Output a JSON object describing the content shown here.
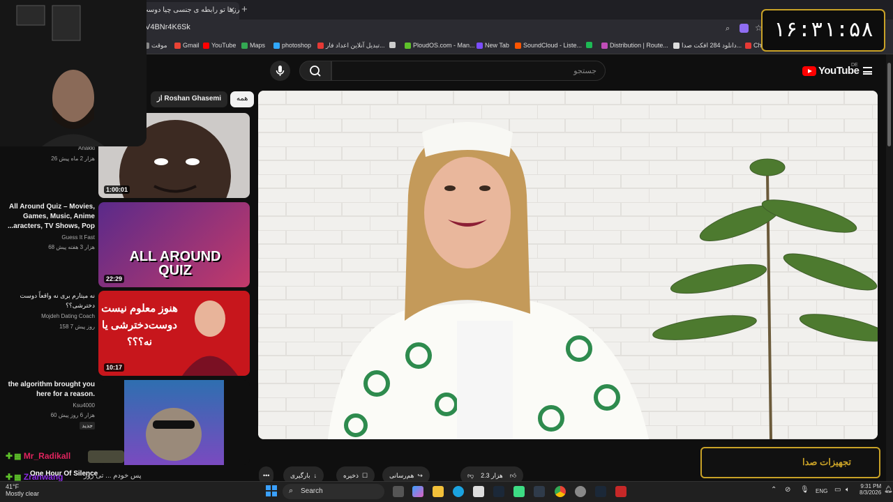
{
  "browser": {
    "tab_title": "مرزها تو رابطه ی جنسی چیا دوست",
    "url": "V4BNr4K6Sk",
    "bookmarks": [
      {
        "label": "موقت",
        "color": "#888888"
      },
      {
        "label": "Gmail",
        "color": "#ea4335"
      },
      {
        "label": "YouTube",
        "color": "#ff0000"
      },
      {
        "label": "Maps",
        "color": "#34a853"
      },
      {
        "label": "photoshop",
        "color": "#31a8ff"
      },
      {
        "label": "تبدیل آنلاین اعداد فار...",
        "color": "#e53935"
      },
      {
        "label": "",
        "color": "#cccccc"
      },
      {
        "label": "PloudOS.com - Man...",
        "color": "#5ec22a"
      },
      {
        "label": "New Tab",
        "color": "#7b4dff"
      },
      {
        "label": "SoundCloud - Liste...",
        "color": "#ff5500"
      },
      {
        "label": "",
        "color": "#1db954"
      },
      {
        "label": "Distribution | Route...",
        "color": "#c04db8"
      },
      {
        "label": "دانلود 284 افکت صدا...",
        "color": "#dddddd"
      },
      {
        "label": "Ch",
        "color": "#e53935"
      }
    ]
  },
  "youtube": {
    "logo_text": "YouTube",
    "region": "DE",
    "search_placeholder": "جستجو",
    "chips": {
      "all": "همه",
      "from": "از Roshan Ghasemi"
    }
  },
  "recommendations": [
    {
      "title": "",
      "channel": "Anakki",
      "meta": "26 هزار  2 ماه پیش",
      "duration": "1:00:01",
      "thumb_color": "#c7c4c2"
    },
    {
      "title": "All Around Quiz – Movies, Games, Music, Anime ...aracters, TV Shows, Pop",
      "channel": "Guess It Fast",
      "meta": "68 هزار  3 هفته پیش",
      "duration": "22:29",
      "thumb_color": "#7a3aa0",
      "thumb_text": "ALL AROUND QUIZ"
    },
    {
      "title": "نه میتارم بری نه واقعاً دوست دخترشی؟؟",
      "channel": "Mojdeh Dating Coach",
      "meta": "158  7 روز پیش",
      "duration": "10:17",
      "thumb_color": "#c7161c",
      "thumb_text": "هنوز معلوم نیست دوست‌دخترشی یا نه؟؟؟"
    },
    {
      "title": "the algorithm brought you here for a reason.",
      "channel": "Ksu4000",
      "meta": "60 هزار  6 روز پیش",
      "badge": "جدید",
      "thumb_color": "#4b2f8a"
    }
  ],
  "overlay": {
    "clock": "۱۶:۳۱:۵۸",
    "sound_label": "تجهیزات صدا"
  },
  "actions": {
    "likes": "2.3 هزار",
    "share": "هم‌رسانی",
    "save": "ذخیره",
    "download": "بارگیری",
    "more": "•••"
  },
  "chat": [
    {
      "user": "Mr_Radikall",
      "color": "#e0245e"
    },
    {
      "user": "Zranwang",
      "color": "#8a2be2"
    }
  ],
  "overlay_texts": {
    "ticker": "One Hour Of Silence",
    "persian_fragment": "پس خودم ... تی روز",
    "weather_temp": "41°F",
    "weather_desc": "Mostly clear"
  },
  "taskbar": {
    "search_label": "Search",
    "language": "ENG",
    "time": "9:31 PM",
    "date": "8/3/2026"
  }
}
